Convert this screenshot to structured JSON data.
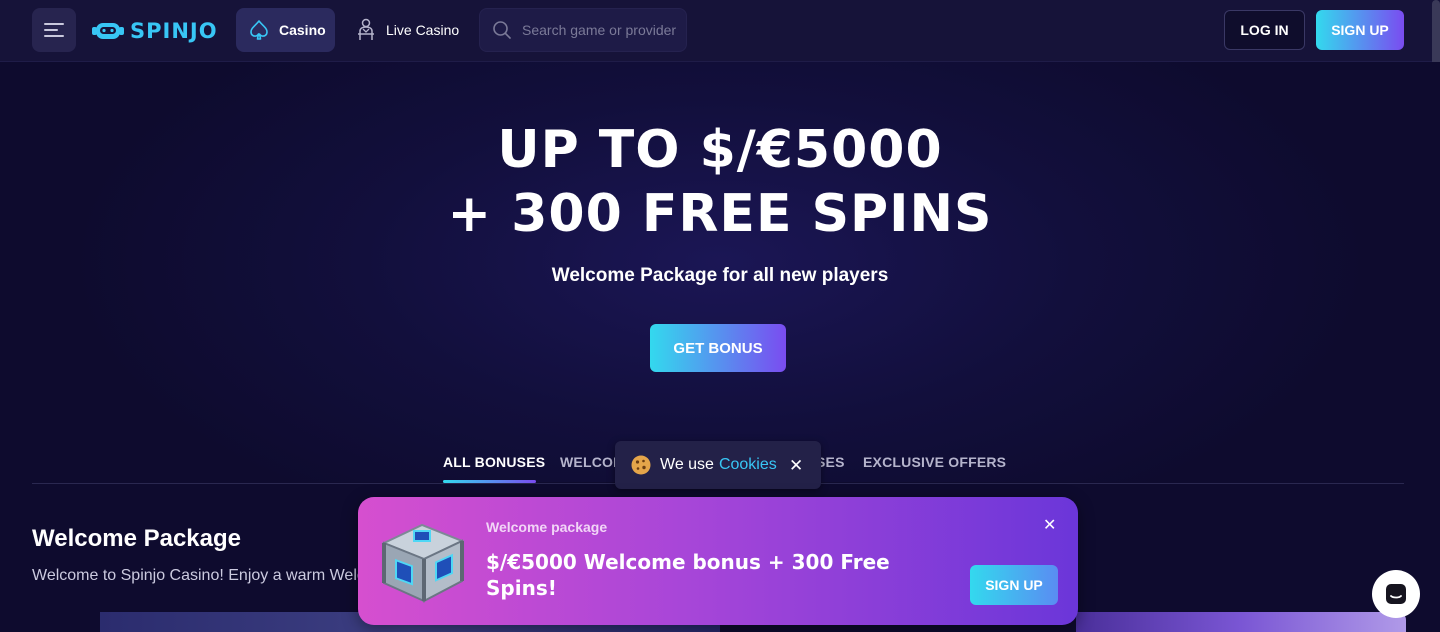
{
  "header": {
    "logo_text": "SPINJO",
    "nav_casino": "Casino",
    "nav_live_casino": "Live Casino",
    "search_placeholder": "Search game or provider",
    "login_label": "LOG IN",
    "signup_label": "SIGN UP"
  },
  "hero": {
    "title_line1": "UP TO $/€5000",
    "title_line2": "+ 300 FREE SPINS",
    "subtitle": "Welcome Package for all new players",
    "cta_label": "GET BONUS"
  },
  "tabs": [
    {
      "label": "ALL BONUSES",
      "active": true
    },
    {
      "label": "WELCOM",
      "active": false
    },
    {
      "label": "SES",
      "active": false
    },
    {
      "label": "EXCLUSIVE OFFERS",
      "active": false
    }
  ],
  "section": {
    "title": "Welcome Package",
    "description": "Welcome to Spinjo Casino! Enjoy a warm Welc"
  },
  "cookie": {
    "text": "We use",
    "link": "Cookies",
    "close": "✕"
  },
  "promo": {
    "label": "Welcome package",
    "text": "$/€5000 Welcome bonus + 300 Free Spins!",
    "button": "SIGN UP",
    "close": "✕"
  },
  "colors": {
    "background": "#0e0b2e",
    "accent_cyan": "#33d9ee",
    "accent_purple": "#7a4cf0",
    "link": "#38c6f5"
  },
  "icons": {
    "menu": "hamburger-icon",
    "casino": "spade-icon",
    "live_casino": "dealer-icon",
    "search": "search-icon",
    "cookie": "cookie-icon",
    "chat": "chat-icon"
  }
}
